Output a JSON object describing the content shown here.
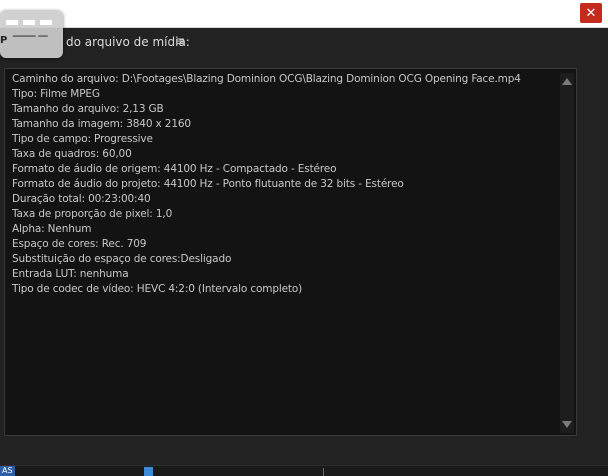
{
  "window": {
    "close_label": "✕"
  },
  "panel": {
    "title": "do arquivo de mídia:",
    "menu_icon": "hamburger-menu-icon",
    "menu_glyph": "≡",
    "overlay_text": "P ‾‾‾‾‾ ‾‾",
    "overlay_label": "Propriedades"
  },
  "info": {
    "lines": [
      "Caminho do arquivo: D:\\Footages\\Blazing Dominion OCG\\Blazing Dominion OCG Opening Face.mp4",
      "Tipo: Filme MPEG",
      "Tamanho do arquivo: 2,13 GB",
      "Tamanho da imagem: 3840 x 2160",
      "Tipo de campo: Progressive",
      "Taxa de quadros: 60,00",
      "Formato de áudio de origem: 44100 Hz - Compactado - Estéreo",
      "Formato de áudio do projeto: 44100 Hz - Ponto flutuante de 32 bits - Estéreo",
      "Duração total: 00:23:00:40",
      "Taxa de proporção de pixel: 1,0",
      "Alpha: Nenhum",
      "Espaço de cores: Rec. 709",
      "Substituição do espaço de cores:Desligado",
      "Entrada LUT: nenhuma",
      "Tipo de codec de vídeo: HEVC 4:2:0  (Intervalo completo)"
    ]
  },
  "status": {
    "tag": "AS"
  },
  "colors": {
    "panel_bg": "#222222",
    "info_bg": "#131313",
    "text": "#c8c8c8",
    "close_red": "#c42b1c",
    "accent_blue": "#3d8ad6"
  }
}
